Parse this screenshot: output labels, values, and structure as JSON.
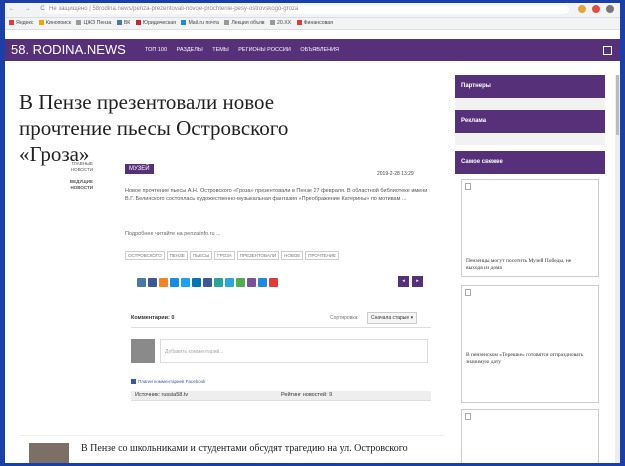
{
  "browser": {
    "nav": "← → C",
    "url": "Не защищено | 58rodina.news/penza-prezentovali-novoe-prochtenie-pesy-ostrovskogo-groza",
    "bookmarks": [
      "Яндекс",
      "Кинопоиск",
      "ЦЖЗ Пенза",
      "ВК",
      "Юридическая",
      "Mail.ru почта",
      "Лекция объяв",
      "20.ХХ",
      "Финансовая"
    ]
  },
  "site": {
    "logo": "58. RODINA.NEWS",
    "menu": [
      "ТОП 100",
      "РАЗДЕЛЫ",
      "ТЕМЫ",
      "РЕГИОНЫ РОССИИ",
      "ОБЪЯВЛЕНИЯ"
    ]
  },
  "article": {
    "title": "В Пензе презентовали новое прочтение пьесы Островского «Гроза»",
    "cat1": "ГЛАВНЫЕ НОВОСТИ",
    "cat2": "ВЕДУЩИЕ НОВОСТИ",
    "tag": "МУЗЕЙ",
    "date": "2019-2-28 13:29",
    "lead": "Новое прочтение пьесы А.Н. Островского «Гроза» презентовали в Пензе 27 февраля. В областной библиотеке имени В.Г. Белинского состоялась художественно-музыкальная фантазия «Преображение Катерины» по мотивам ...",
    "more": "Подробнее читайте на penzainfo.ru ...",
    "tags": [
      "ОСТРОВСКОГО",
      "ПЕНЗЕ",
      "ПЬЕСЫ",
      "ГРОЗА",
      "ПРЕЗЕНТОВАЛИ",
      "НОВОЕ",
      "ПРОЧТЕНИЕ"
    ],
    "pager": [
      "◂",
      "▸"
    ]
  },
  "comments": {
    "count": "Комментарии: 0",
    "sort_label": "Сортировка",
    "sort_value": "Сначала старые ▾",
    "placeholder": "Добавить комментарий...",
    "plugin": "Плагин комментариев Facebook",
    "source": "Источник: russia58.tv",
    "rating": "Рейтинг новостей: 9"
  },
  "related": {
    "text": "В Пензе со школьниками и студентами обсудят трагедию на ул. Островского"
  },
  "sidebar": {
    "partners": "Партнеры",
    "ads": "Реклама",
    "fresh": "Самое свежее",
    "card1": "Пензенцы могут посетить Музей Победы, не выходя из дома",
    "card2": "В пензенском «Терешке» готовятся отпраздновать значимую дату"
  },
  "colors": {
    "brand": "#57307a",
    "frame": "#1a3fa8"
  }
}
